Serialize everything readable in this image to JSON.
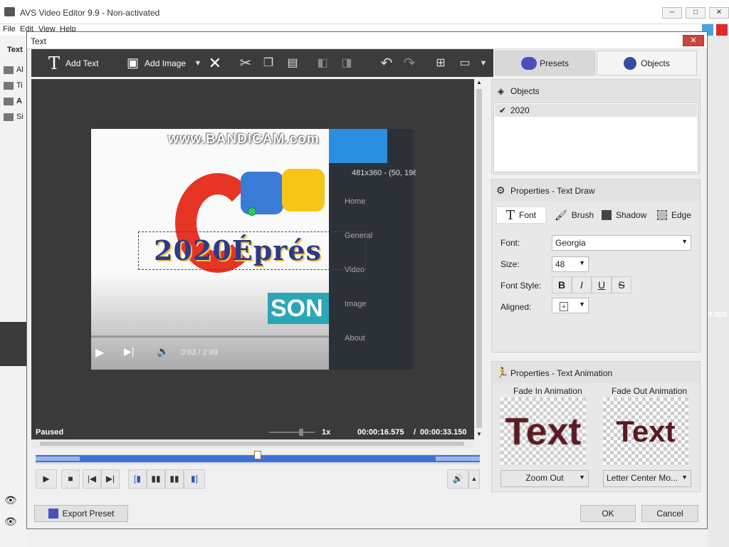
{
  "app": {
    "title": "AVS Video Editor 9.9 - Non-activated",
    "menu": [
      "File",
      "Edit",
      "View",
      "Help"
    ],
    "bg_label_text": "Text",
    "bg_items": [
      "Al",
      "Ti",
      "A",
      "Si"
    ],
    "bg_time": "0.000"
  },
  "dialog": {
    "title": "Text",
    "close_label": "✕"
  },
  "toolbar": {
    "add_text": "Add Text",
    "add_image": "Add Image"
  },
  "tabs": {
    "presets": "Presets",
    "objects": "Objects"
  },
  "preview": {
    "watermark": "www.BANDICAM.com",
    "resolution": "481x360 - (50, 196",
    "nav": [
      "Home",
      "General",
      "Video",
      "Image",
      "About"
    ],
    "video_time": "0:03 / 2:49",
    "overlay_text": "2020Éprés",
    "brand_fragment": "SON",
    "status": "Paused",
    "speed": "1x",
    "current_time": "00:00:16.575",
    "separator": "/",
    "total_time": "00:00:33.150"
  },
  "objects_panel": {
    "title": "Objects",
    "items": [
      {
        "label": "2020",
        "checked": true
      }
    ]
  },
  "text_draw": {
    "title": "Properties - Text Draw",
    "tabs": [
      "Font",
      "Brush",
      "Shadow",
      "Edge"
    ],
    "font_label": "Font:",
    "font_value": "Georgia",
    "size_label": "Size:",
    "size_value": "48",
    "style_label": "Font Style:",
    "style_buttons": [
      "B",
      "I",
      "U",
      "S"
    ],
    "aligned_label": "Aligned:"
  },
  "text_animation": {
    "title": "Properties - Text Animation",
    "fade_in_label": "Fade In Animation",
    "fade_out_label": "Fade Out Animation",
    "preview_text": "Text",
    "fade_in_value": "Zoom Out",
    "fade_out_value": "Letter Center Mo..."
  },
  "footer": {
    "export": "Export Preset",
    "ok": "OK",
    "cancel": "Cancel"
  }
}
